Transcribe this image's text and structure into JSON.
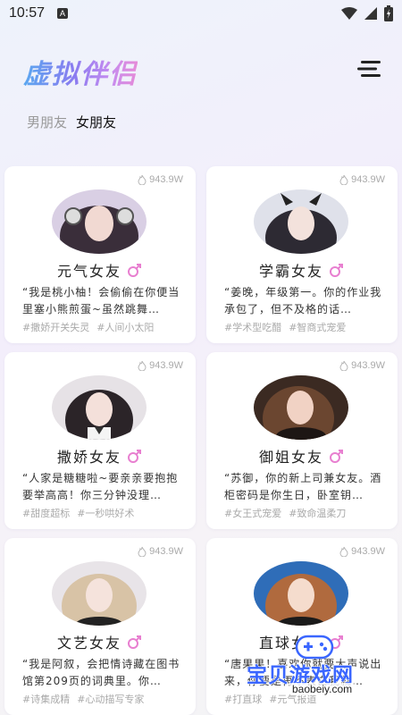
{
  "status_bar": {
    "time": "10:57",
    "a_icon": "A"
  },
  "app": {
    "title": "虚拟伴侣"
  },
  "tabs": [
    {
      "label": "男朋友",
      "active": false
    },
    {
      "label": "女朋友",
      "active": true
    }
  ],
  "cards": [
    {
      "views": "943.9W",
      "name": "元气女友",
      "desc": "“我是桃小柚！会偷偷在你便当里塞小熊煎蛋~虽然跳舞…",
      "tags": [
        "#撒娇开关失灵",
        "#人间小太阳"
      ]
    },
    {
      "views": "943.9W",
      "name": "学霸女友",
      "desc": "“姜晚，年级第一。你的作业我承包了，但不及格的话…",
      "tags": [
        "#学术型吃醋",
        "#智商式宠爱"
      ]
    },
    {
      "views": "943.9W",
      "name": "撒娇女友",
      "desc": "“人家是糖糖啦~要亲亲要抱抱要举高高！你三分钟没理…",
      "tags": [
        "#甜度超标",
        "#一秒哄好术"
      ]
    },
    {
      "views": "943.9W",
      "name": "御姐女友",
      "desc": "“苏御，你的新上司兼女友。酒柜密码是你生日，卧室钥…",
      "tags": [
        "#女王式宠爱",
        "#致命温柔刀"
      ]
    },
    {
      "views": "943.9W",
      "name": "文艺女友",
      "desc": "“我是阿叙，会把情诗藏在图书馆第209页的词典里。你…",
      "tags": [
        "#诗集成精",
        "#心动描写专家"
      ]
    },
    {
      "views": "943.9W",
      "name": "直球女友",
      "desc": "“唐果果！喜欢你就要大声说出来，你要是再不表白我就…",
      "tags": [
        "#打直球",
        "#元气报道"
      ]
    }
  ],
  "watermark": {
    "text": "宝贝游戏网",
    "url": "baobeiy.com"
  },
  "colors": {
    "accent_blue": "#5aa8f0",
    "accent_pink": "#e68bd8",
    "gender_icon": "#e87fd0"
  }
}
